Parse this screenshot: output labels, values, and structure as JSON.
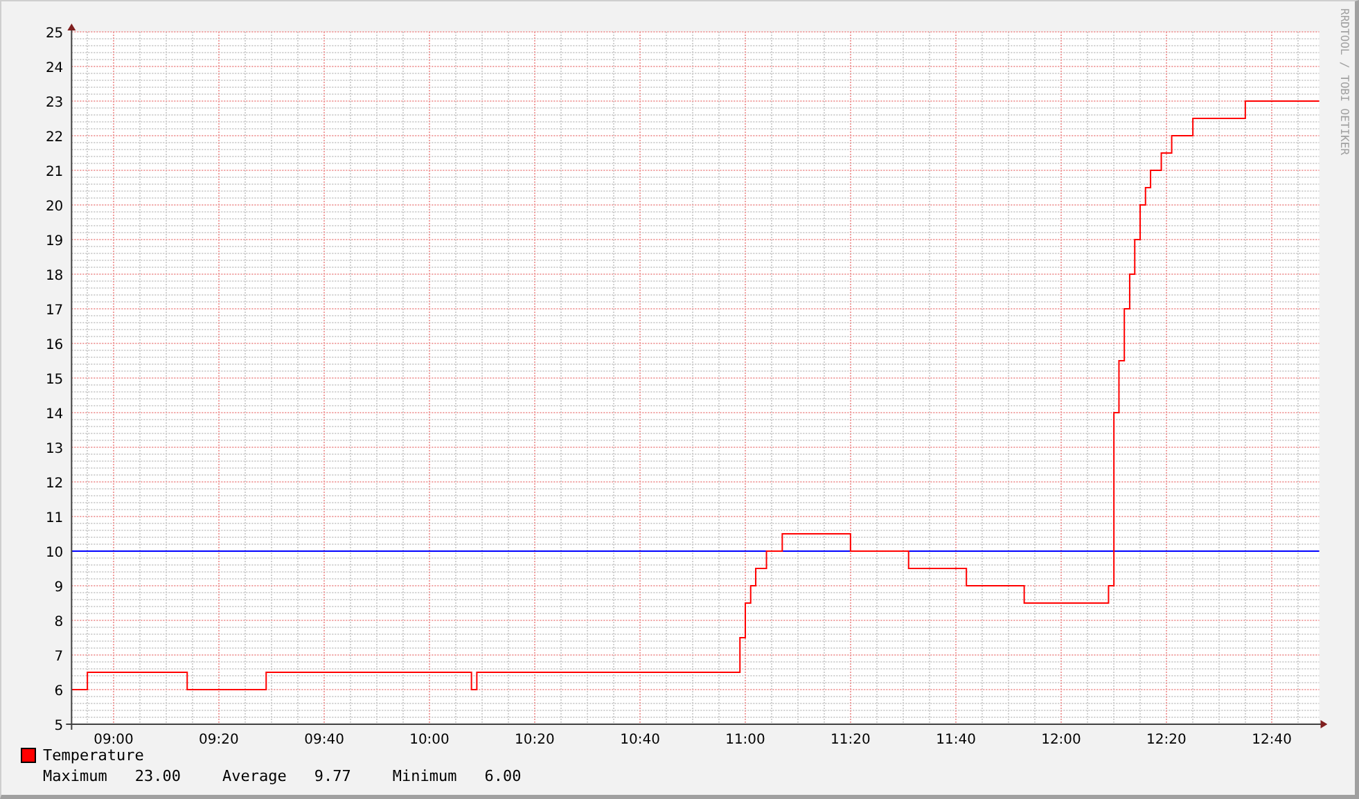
{
  "graph": {
    "chart_data": {
      "type": "line",
      "x": [
        8.867,
        8.917,
        8.917,
        9.233,
        9.233,
        9.483,
        9.483,
        10.133,
        10.133,
        10.15,
        10.15,
        10.983,
        10.983,
        11,
        11,
        11.017,
        11.017,
        11.033,
        11.033,
        11.067,
        11.067,
        11.117,
        11.117,
        11.333,
        11.333,
        11.517,
        11.517,
        11.7,
        11.7,
        11.883,
        11.883,
        12.15,
        12.15,
        12.167,
        12.167,
        12.183,
        12.183,
        12.2,
        12.2,
        12.217,
        12.217,
        12.233,
        12.233,
        12.25,
        12.25,
        12.267,
        12.267,
        12.283,
        12.283,
        12.317,
        12.317,
        12.35,
        12.35,
        12.417,
        12.417,
        12.583,
        12.583,
        12.817
      ],
      "series": [
        {
          "name": "Temperature",
          "color": "#ff0000",
          "values": [
            6,
            6,
            6.5,
            6.5,
            6,
            6,
            6.5,
            6.5,
            6,
            6,
            6.5,
            6.5,
            7.5,
            7.5,
            8.5,
            8.5,
            9,
            9,
            9.5,
            9.5,
            10,
            10,
            10.5,
            10.5,
            10,
            10,
            9.5,
            9.5,
            9,
            9,
            8.5,
            8.5,
            9,
            9,
            14,
            14,
            15.5,
            15.5,
            17,
            17,
            18,
            18,
            19,
            19,
            20,
            20,
            20.5,
            20.5,
            21,
            21,
            21.5,
            21.5,
            22,
            22,
            22.5,
            22.5,
            23,
            23
          ]
        }
      ],
      "xlim": [
        8.867,
        12.817
      ],
      "ylim": [
        5,
        25
      ],
      "xticks": [
        {
          "value": 9,
          "label": "09:00"
        },
        {
          "value": 9.333,
          "label": "09:20"
        },
        {
          "value": 9.667,
          "label": "09:40"
        },
        {
          "value": 10,
          "label": "10:00"
        },
        {
          "value": 10.333,
          "label": "10:20"
        },
        {
          "value": 10.667,
          "label": "10:40"
        },
        {
          "value": 11,
          "label": "11:00"
        },
        {
          "value": 11.333,
          "label": "11:20"
        },
        {
          "value": 11.667,
          "label": "11:40"
        },
        {
          "value": 12,
          "label": "12:00"
        },
        {
          "value": 12.333,
          "label": "12:20"
        },
        {
          "value": 12.667,
          "label": "12:40"
        }
      ],
      "grid": true,
      "yticks": [
        5,
        6,
        7,
        8,
        9,
        10,
        11,
        12,
        13,
        14,
        15,
        16,
        17,
        18,
        19,
        20,
        21,
        22,
        23,
        24,
        25
      ],
      "ref_lines": [
        {
          "axis": "y",
          "value": 10,
          "color": "#0000ff"
        }
      ]
    },
    "credit": "RRDTOOL / TOBI OETIKER"
  },
  "legend": {
    "stats": [
      {
        "label": "Maximum",
        "value": "23.00"
      },
      {
        "label": "Average",
        "value": "9.77"
      },
      {
        "label": "Minimum",
        "value": "6.00"
      }
    ]
  }
}
